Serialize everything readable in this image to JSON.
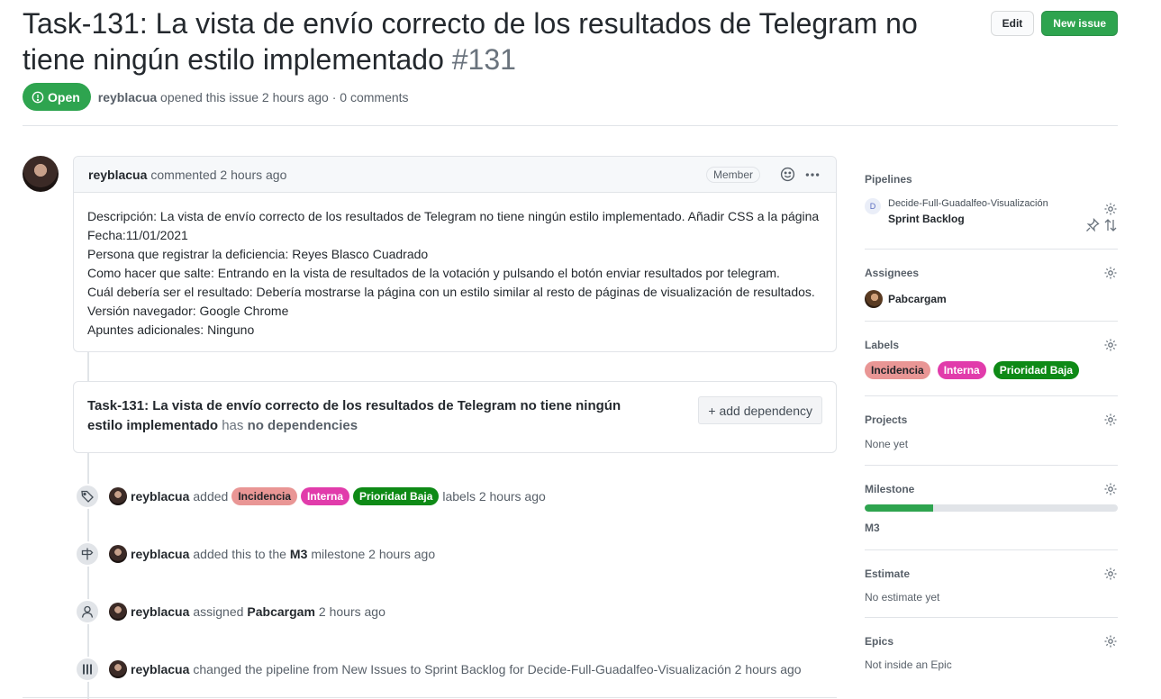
{
  "issue": {
    "title": "Task-131: La vista de envío correcto de los resultados de Telegram no tiene ningún estilo implementado",
    "number": "#131",
    "state": "Open",
    "author": "reyblacua",
    "opened_text": "opened this issue 2 hours ago · 0 comments"
  },
  "header_actions": {
    "edit_label": "Edit",
    "new_issue_label": "New issue"
  },
  "comment": {
    "author": "reyblacua",
    "time_text": "commented 2 hours ago",
    "role_badge": "Member",
    "lines": [
      "Descripción: La vista de envío correcto de los resultados de Telegram no tiene ningún estilo implementado. Añadir CSS a la página",
      "Fecha:11/01/2021",
      "Persona que registrar la deficiencia: Reyes Blasco Cuadrado",
      "Como hacer que salte: Entrando en la vista de resultados de la votación y pulsando el botón enviar resultados por telegram.",
      "Cuál debería ser el resultado: Debería mostrarse la página con un estilo similar al resto de páginas de visualización de resultados.",
      "Versión navegador: Google Chrome",
      "Apuntes adicionales: Ninguno"
    ]
  },
  "dependencies": {
    "issue_title": "Task-131: La vista de envío correcto de los resultados de Telegram no tiene ningún estilo implementado",
    "has_text": "has",
    "none_text": "no dependencies",
    "add_button": "+ add dependency"
  },
  "events": {
    "labels_event": {
      "actor": "reyblacua",
      "verb": "added",
      "labels": [
        "Incidencia",
        "Interna",
        "Prioridad Baja"
      ],
      "suffix": "labels 2 hours ago"
    },
    "milestone_event": {
      "actor": "reyblacua",
      "verb": "added this to the",
      "milestone": "M3",
      "suffix": "milestone 2 hours ago"
    },
    "assign_event": {
      "actor": "reyblacua",
      "verb": "assigned",
      "assignee": "Pabcargam",
      "suffix": "2 hours ago"
    },
    "pipeline_event": {
      "actor": "reyblacua",
      "text": "changed the pipeline from New Issues to Sprint Backlog for Decide-Full-Guadalfeo-Visualización 2 hours ago"
    }
  },
  "sidebar": {
    "pipelines": {
      "title": "Pipelines",
      "repo_initial": "D",
      "repo": "Decide-Full-Guadalfeo-Visualización",
      "stage": "Sprint Backlog"
    },
    "assignees": {
      "title": "Assignees",
      "name": "Pabcargam"
    },
    "labels": {
      "title": "Labels",
      "items": [
        "Incidencia",
        "Interna",
        "Prioridad Baja"
      ]
    },
    "projects": {
      "title": "Projects",
      "value": "None yet"
    },
    "milestone": {
      "title": "Milestone",
      "name": "M3",
      "progress": 0.27
    },
    "estimate": {
      "title": "Estimate",
      "value": "No estimate yet"
    },
    "epics": {
      "title": "Epics",
      "value": "Not inside an Epic"
    }
  },
  "colors": {
    "green": "#2ea44f",
    "label_incidencia": "#e99695",
    "label_interna": "#e13cab",
    "label_prioridad_baja": "#0e8a16"
  }
}
